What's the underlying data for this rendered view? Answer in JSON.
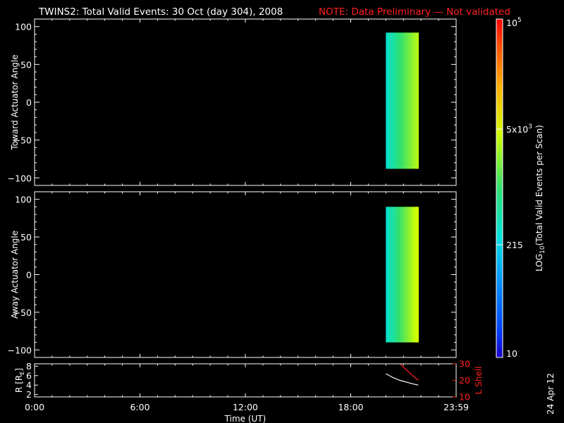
{
  "title": "TWINS2: Total Valid Events: 30 Oct (day 304), 2008",
  "note": "NOTE: Data Preliminary — Not validated",
  "date_stamp": "24 Apr 12",
  "colors": {
    "background": "#000000",
    "foreground": "#ffffff",
    "note": "#ff2020",
    "r_line": "#ffffff",
    "l_shell_line": "#ff2020"
  },
  "colorbar": {
    "label": "LOG10(Total Valid Events per Scan)",
    "label_main": "LOG",
    "label_sub": "10",
    "label_rest": "(Total Valid Events per Scan)",
    "scale": "log",
    "range": [
      10,
      100000
    ],
    "colormap": "rainbow (blue → cyan → green → yellow → orange → red)",
    "ticks": [
      {
        "value": 10,
        "label": "10"
      },
      {
        "value": 215,
        "label": "215"
      },
      {
        "value": 5000,
        "label": "5x10",
        "exp": "3"
      },
      {
        "value": 100000,
        "label": "10",
        "exp": "5"
      }
    ]
  },
  "chart_data": [
    {
      "type": "heatmap",
      "ylabel": "Toward Actuator Angle",
      "xlim": [
        0,
        24
      ],
      "ylim": [
        -110,
        110
      ],
      "yticks": [
        100,
        50,
        0,
        -50,
        -100
      ],
      "ytick_labels": [
        "100",
        "50",
        "0",
        "−50",
        "−100"
      ],
      "xticks": [
        0,
        6,
        12,
        18,
        24
      ],
      "data": {
        "t_start": 20.0,
        "t_end": 21.85,
        "angle_min": -88,
        "angle_max": 92,
        "log_events_start": 2.55,
        "log_events_end": 3.55
      }
    },
    {
      "type": "heatmap",
      "ylabel": "Away Actuator Angle",
      "xlim": [
        0,
        24
      ],
      "ylim": [
        -110,
        110
      ],
      "yticks": [
        100,
        50,
        0,
        -50,
        -100
      ],
      "ytick_labels": [
        "100",
        "50",
        "0",
        "−50",
        "−100"
      ],
      "xticks": [
        0,
        6,
        12,
        18,
        24
      ],
      "data": {
        "t_start": 20.0,
        "t_end": 21.85,
        "angle_min": -90,
        "angle_max": 90,
        "log_events_start": 2.55,
        "log_events_end": 3.7
      }
    },
    {
      "type": "line",
      "ylabel": "R [R",
      "ylabel_sub": "E",
      "ylabel_end": "]",
      "y2label": "L Shell",
      "xlabel": "Time (UT)",
      "xlim": [
        0,
        24
      ],
      "ylim": [
        1.5,
        8.5
      ],
      "y2lim": [
        10,
        30
      ],
      "yticks": [
        2,
        4,
        6,
        8
      ],
      "ytick_labels": [
        "2",
        "4",
        "6",
        "8"
      ],
      "y2ticks": [
        10,
        20,
        30
      ],
      "y2tick_labels": [
        "10",
        "20",
        "30"
      ],
      "xticks": [
        0,
        6,
        12,
        18,
        24
      ],
      "xtick_labels": [
        "0:00",
        "6:00",
        "12:00",
        "18:00",
        "23:59"
      ],
      "series": [
        {
          "name": "R",
          "axis": "left",
          "x": [
            20.0,
            20.4,
            20.8,
            21.2,
            21.6,
            21.85
          ],
          "y": [
            6.4,
            5.6,
            5.0,
            4.6,
            4.2,
            4.0
          ]
        },
        {
          "name": "L Shell",
          "axis": "right",
          "x": [
            20.6,
            21.0,
            21.4,
            21.85
          ],
          "y": [
            32,
            28,
            24,
            20
          ]
        }
      ]
    }
  ]
}
